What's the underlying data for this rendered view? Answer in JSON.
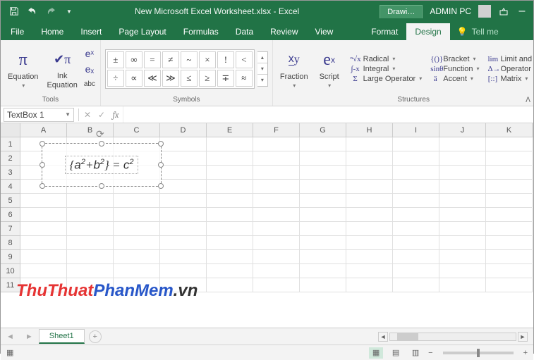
{
  "title": "New Microsoft Excel Worksheet.xlsx - Excel",
  "titlebar": {
    "drawing_tab": "Drawi…",
    "user": "ADMIN PC"
  },
  "tabs": {
    "file": "File",
    "home": "Home",
    "insert": "Insert",
    "page_layout": "Page Layout",
    "formulas": "Formulas",
    "data": "Data",
    "review": "Review",
    "view": "View",
    "format": "Format",
    "design": "Design",
    "tell_me": "Tell me"
  },
  "ribbon": {
    "tools": {
      "label": "Tools",
      "equation": "Equation",
      "ink": "Ink\nEquation"
    },
    "symbols": {
      "label": "Symbols",
      "cells": [
        "±",
        "∞",
        "=",
        "≠",
        "~",
        "×",
        "!",
        "<",
        "÷",
        "∝",
        "≪",
        "≫",
        "≤",
        "≥",
        "∓",
        "≈"
      ]
    },
    "fraction": "Fraction",
    "script": "Script",
    "structures_label": "Structures",
    "col1": [
      "Radical",
      "Integral",
      "Large Operator"
    ],
    "col2": [
      "Bracket",
      "Function",
      "Accent"
    ],
    "col3": [
      "Limit and Log",
      "Operator",
      "Matrix"
    ],
    "prefixes": {
      "radical": "ⁿ√x",
      "integral": "∫-x",
      "large": "Σ",
      "bracket": "{()}",
      "function": "sinθ",
      "accent": "ä",
      "limit": "lim",
      "operator": "Δ→",
      "matrix": "[::]"
    }
  },
  "name_box": "TextBox 1",
  "columns": [
    "A",
    "B",
    "C",
    "D",
    "E",
    "F",
    "G",
    "H",
    "I",
    "J",
    "K"
  ],
  "rows": [
    "1",
    "2",
    "3",
    "4",
    "5",
    "6",
    "7",
    "8",
    "9",
    "10",
    "11"
  ],
  "equation_html": "{<i>a</i><sup>2</sup>+<i>b</i><sup>2</sup>} = <i>c</i><sup>2</sup>",
  "sheet_tab": "Sheet1",
  "watermark": {
    "p1": "ThuThuat",
    "p2": "PhanMem",
    "p3": ".vn"
  }
}
